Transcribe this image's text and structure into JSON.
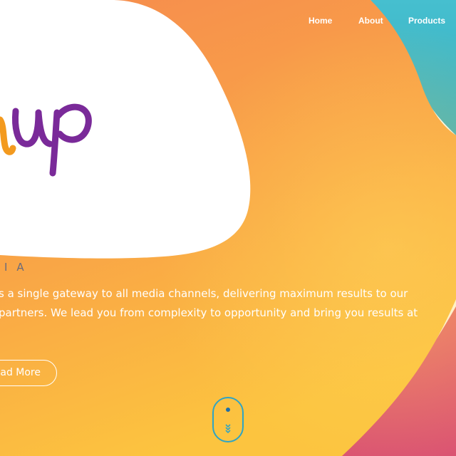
{
  "nav": {
    "items": [
      {
        "label": "Home"
      },
      {
        "label": "About"
      },
      {
        "label": "Products"
      }
    ]
  },
  "logo": {
    "wordmark": "up",
    "sub": "IA"
  },
  "hero": {
    "intro_lines": [
      "s a single gateway to all media channels, delivering maximum results to our",
      "partners. We lead you from complexity to opportunity and bring you results at"
    ],
    "read_more_label": "ead More"
  },
  "scroll_indicator": {
    "icon": "mouse-scroll-icon"
  },
  "colors": {
    "orange": "#f6924c",
    "yellow": "#fbc343",
    "teal": "#39b6c6",
    "pink": "#e0526e",
    "logo_purple": "#7a2a99",
    "logo_orange": "#f39a1f",
    "scroll_blue": "#2fa4c4"
  }
}
